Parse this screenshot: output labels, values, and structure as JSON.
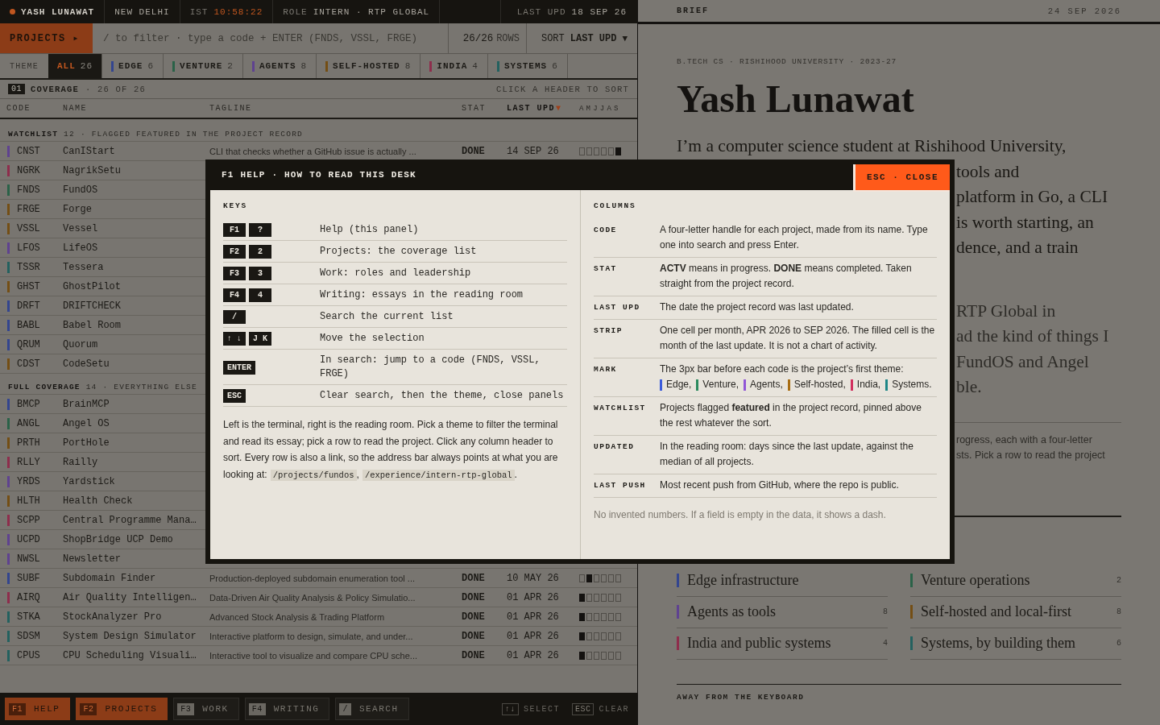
{
  "top_bar": {
    "name": "YASH LUNAWAT",
    "city": "NEW DELHI",
    "clock_label": "IST",
    "clock": "10:58:22",
    "role_label": "ROLE",
    "role": "INTERN · RTP GLOBAL",
    "updated_label": "LAST UPD",
    "updated": "18 SEP 26"
  },
  "filter_bar": {
    "view": "PROJECTS ▸",
    "placeholder": "/ to filter · type a code + ENTER (FNDS, VSSL, FRGE)",
    "row_count": "26/26",
    "row_unit": "ROWS",
    "sort_label": "SORT",
    "sort_value": "LAST UPD",
    "sort_caret": "▼"
  },
  "theme_tabs": {
    "label": "THEME",
    "tabs": [
      {
        "label": "ALL",
        "count": "26",
        "selected": true
      },
      {
        "label": "EDGE",
        "count": "6",
        "selected": false,
        "color": "#33458f"
      },
      {
        "label": "VENTURE",
        "count": "2",
        "selected": false,
        "color": "#2a6248"
      },
      {
        "label": "AGENTS",
        "count": "8",
        "selected": false,
        "color": "#5f4290"
      },
      {
        "label": "SELF-HOSTED",
        "count": "8",
        "selected": false,
        "color": "#744e14"
      },
      {
        "label": "INDIA",
        "count": "4",
        "selected": false,
        "color": "#8e2d4c"
      },
      {
        "label": "SYSTEMS",
        "count": "6",
        "selected": false,
        "color": "#23615f"
      }
    ]
  },
  "coverage": {
    "index": "01",
    "title": "COVERAGE",
    "summary": "· 26 OF 26",
    "hint": "CLICK A HEADER TO SORT"
  },
  "columns": [
    {
      "label": "CODE",
      "sorted": false
    },
    {
      "label": "NAME",
      "sorted": false
    },
    {
      "label": "TAGLINE",
      "sorted": false
    },
    {
      "label": "STAT",
      "sorted": false
    },
    {
      "label": "LAST UPD",
      "sorted": true,
      "sort_indicator": "▼"
    },
    {
      "label": "AMJJAS",
      "sorted": false
    }
  ],
  "sections": [
    {
      "title": "WATCHLIST",
      "count": "12",
      "note": "· FLAGGED FEATURED IN THE PROJECT RECORD",
      "rows": [
        {
          "code": "CNST",
          "name": "CanIStart",
          "color": "#5f4290",
          "tagline": "CLI that checks whether a GitHub issue is actually ...",
          "status": "DONE",
          "updated": "14 SEP 26",
          "strip": [
            {
              "filled": false
            },
            {
              "filled": false
            },
            {
              "filled": false
            },
            {
              "filled": false
            },
            {
              "filled": false
            },
            {
              "filled": true
            }
          ]
        },
        {
          "code": "NGRK",
          "name": "NagrikSetu",
          "color": "#8e2d4c"
        },
        {
          "code": "FNDS",
          "name": "FundOS",
          "color": "#2a6248"
        },
        {
          "code": "FRGE",
          "name": "Forge",
          "color": "#744e14"
        },
        {
          "code": "VSSL",
          "name": "Vessel",
          "color": "#744e14"
        },
        {
          "code": "LFOS",
          "name": "LifeOS",
          "color": "#5f4290"
        },
        {
          "code": "TSSR",
          "name": "Tessera",
          "color": "#23615f"
        },
        {
          "code": "GHST",
          "name": "GhostPilot",
          "color": "#744e14"
        },
        {
          "code": "DRFT",
          "name": "DRIFTCHECK",
          "color": "#33458f"
        },
        {
          "code": "BABL",
          "name": "Babel Room",
          "color": "#33458f"
        },
        {
          "code": "QRUM",
          "name": "Quorum",
          "color": "#33458f"
        },
        {
          "code": "CDST",
          "name": "CodeSetu",
          "color": "#744e14"
        }
      ]
    },
    {
      "title": "FULL COVERAGE",
      "count": "14",
      "note": "· EVERYTHING ELSE",
      "rows": [
        {
          "code": "BMCP",
          "name": "BrainMCP",
          "color": "#33458f"
        },
        {
          "code": "ANGL",
          "name": "Angel OS",
          "color": "#2a6248"
        },
        {
          "code": "PRTH",
          "name": "PortHole",
          "color": "#744e14"
        },
        {
          "code": "RLLY",
          "name": "Railly",
          "color": "#8e2d4c"
        },
        {
          "code": "YRDS",
          "name": "Yardstick",
          "color": "#5f4290"
        },
        {
          "code": "HLTH",
          "name": "Health Check",
          "color": "#744e14"
        },
        {
          "code": "SCPP",
          "name": "Central Programme Mana…",
          "color": "#8e2d4c"
        },
        {
          "code": "UCPD",
          "name": "ShopBridge UCP Demo",
          "color": "#5f4290"
        },
        {
          "code": "NWSL",
          "name": "Newsletter",
          "color": "#5f4290"
        },
        {
          "code": "SUBF",
          "name": "Subdomain Finder",
          "color": "#33458f",
          "tagline": "Production-deployed subdomain enumeration tool ...",
          "status": "DONE",
          "updated": "10 MAY 26",
          "strip": [
            {
              "filled": false
            },
            {
              "filled": true
            },
            {
              "filled": false
            },
            {
              "filled": false
            },
            {
              "filled": false
            },
            {
              "filled": false
            }
          ]
        },
        {
          "code": "AIRQ",
          "name": "Air Quality Intelligen…",
          "color": "#8e2d4c",
          "tagline": "Data-Driven Air Quality Analysis & Policy Simulatio...",
          "status": "DONE",
          "updated": "01 APR 26",
          "strip": [
            {
              "filled": true
            },
            {
              "filled": false
            },
            {
              "filled": false
            },
            {
              "filled": false
            },
            {
              "filled": false
            },
            {
              "filled": false
            }
          ]
        },
        {
          "code": "STKA",
          "name": "StockAnalyzer Pro",
          "color": "#23615f",
          "tagline": "Advanced Stock Analysis & Trading Platform",
          "status": "DONE",
          "updated": "01 APR 26",
          "strip": [
            {
              "filled": true
            },
            {
              "filled": false
            },
            {
              "filled": false
            },
            {
              "filled": false
            },
            {
              "filled": false
            },
            {
              "filled": false
            }
          ]
        },
        {
          "code": "SDSM",
          "name": "System Design Simulator",
          "color": "#23615f",
          "tagline": "Interactive platform to design, simulate, and under...",
          "status": "DONE",
          "updated": "01 APR 26",
          "strip": [
            {
              "filled": true
            },
            {
              "filled": false
            },
            {
              "filled": false
            },
            {
              "filled": false
            },
            {
              "filled": false
            },
            {
              "filled": false
            }
          ]
        },
        {
          "code": "CPUS",
          "name": "CPU Scheduling Visuali…",
          "color": "#23615f",
          "tagline": "Interactive tool to visualize and compare CPU sche...",
          "status": "DONE",
          "updated": "01 APR 26",
          "strip": [
            {
              "filled": true
            },
            {
              "filled": false
            },
            {
              "filled": false
            },
            {
              "filled": false
            },
            {
              "filled": false
            },
            {
              "filled": false
            }
          ]
        }
      ]
    }
  ],
  "bottom_bar": {
    "buttons": [
      {
        "key": "F1",
        "label": "HELP",
        "selected": true
      },
      {
        "key": "F2",
        "label": "PROJECTS",
        "selected": true
      },
      {
        "key": "F3",
        "label": "WORK",
        "selected": false
      },
      {
        "key": "F4",
        "label": "WRITING",
        "selected": false
      },
      {
        "key": "/",
        "label": "SEARCH",
        "selected": false
      }
    ],
    "hints": [
      {
        "key": "↑↓",
        "label": "SELECT"
      },
      {
        "key": "ESC",
        "label": "CLEAR"
      }
    ]
  },
  "brief": {
    "title": "BRIEF",
    "date": "24 SEP 2026",
    "meta": "B.TECH CS · RISHIHOOD UNIVERSITY · 2023-27",
    "name": "Yash Lunawat",
    "intro_line": "I’m a computer science student at Rishihood University,",
    "intro_fragments": [
      "tools and",
      "platform in Go, a CLI",
      "is worth starting, an",
      "dence, and a train"
    ],
    "second_fragments": [
      "RTP Global in",
      "ad the kind of things I",
      "FundOS and Angel",
      "ble."
    ],
    "note_fragments": [
      "rogress, each with a four-letter",
      "sts. Pick a row to read the project"
    ],
    "themes": [
      {
        "label": "Edge infrastructure",
        "color": "#33458f"
      },
      {
        "label": "Venture operations",
        "count": "2",
        "color": "#2a6248"
      },
      {
        "label": "Agents as tools",
        "count": "8",
        "color": "#5f4290"
      },
      {
        "label": "Self-hosted and local-first",
        "count": "8",
        "color": "#744e14"
      },
      {
        "label": "India and public systems",
        "count": "4",
        "color": "#8e2d4c"
      },
      {
        "label": "Systems, by building them",
        "count": "6",
        "color": "#23615f"
      }
    ],
    "away_heading": "AWAY FROM THE KEYBOARD"
  },
  "help": {
    "title": "F1 HELP · HOW TO READ THIS DESK",
    "close": "ESC · CLOSE",
    "keys_heading": "KEYS",
    "keys": [
      {
        "keys": [
          "F1",
          "?"
        ],
        "text": "Help (this panel)"
      },
      {
        "keys": [
          "F2",
          "2"
        ],
        "text": "Projects: the coverage list"
      },
      {
        "keys": [
          "F3",
          "3"
        ],
        "text": "Work: roles and leadership"
      },
      {
        "keys": [
          "F4",
          "4"
        ],
        "text": "Writing: essays in the reading room"
      },
      {
        "keys": [
          "/"
        ],
        "text": "Search the current list"
      },
      {
        "keys": [
          "↑ ↓",
          "J K"
        ],
        "text": "Move the selection"
      },
      {
        "keys": [
          "ENTER"
        ],
        "text": "In search: jump to a code (FNDS, VSSL, FRGE)"
      },
      {
        "keys": [
          "ESC"
        ],
        "text": "Clear search, then the theme, close panels"
      }
    ],
    "note": "Left is the terminal, right is the reading room. Pick a theme to filter the terminal and read its essay; pick a row to read the project. Click any column header to sort. Every row is also a link, so the address bar always points at what you are looking at:",
    "paths": [
      {
        "path": "/projects/fundos",
        "after": ","
      },
      {
        "path": "/experience/intern-rtp-global",
        "after": "."
      }
    ],
    "terms_heading": "COLUMNS",
    "terms": [
      {
        "label": "CODE",
        "text": "A four-letter handle for each project, made from its name. Type one into search and press Enter."
      },
      {
        "label": "STAT",
        "text": "**ACTV** means in progress. **DONE** means completed. Taken straight from the project record."
      },
      {
        "label": "LAST UPD",
        "text": "The date the project record was last updated."
      },
      {
        "label": "STRIP",
        "text": "One cell per month, APR 2026 to SEP 2026. The filled cell is the month of the last update. It is not a chart of activity."
      },
      {
        "label": "MARK",
        "text": "The 3px bar before each code is the project’s first theme:",
        "legend": [
          {
            "label": "Edge,",
            "color": "#3b5bdb"
          },
          {
            "label": "Venture,",
            "color": "#2b8a5e"
          },
          {
            "label": "Agents,",
            "color": "#9156d6"
          },
          {
            "label": "Self-hosted,",
            "color": "#a86d12"
          },
          {
            "label": "India,",
            "color": "#d22f5e"
          },
          {
            "label": "Systems.",
            "color": "#1d8686"
          }
        ]
      },
      {
        "label": "WATCHLIST",
        "text": "Projects flagged **featured** in the project record, pinned above the rest whatever the sort."
      },
      {
        "label": "UPDATED",
        "text": "In the reading room: days since the last update, against the median of all projects."
      },
      {
        "label": "LAST PUSH",
        "text": "Most recent push from GitHub, where the repo is public."
      }
    ],
    "footer": "No invented numbers. If a field is empty in the data, it shows a dash."
  }
}
